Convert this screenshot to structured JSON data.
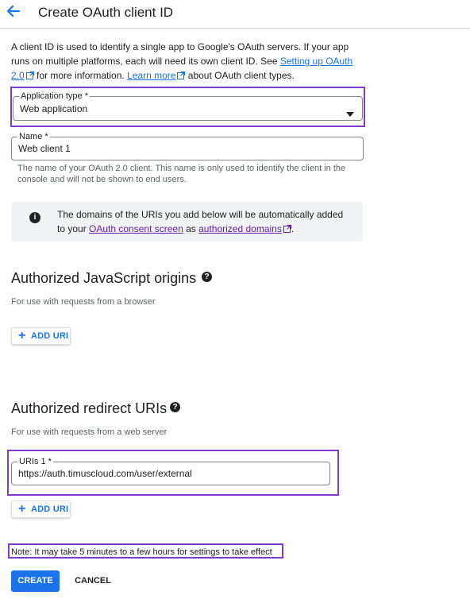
{
  "header": {
    "title": "Create OAuth client ID"
  },
  "intro": {
    "text1": "A client ID is used to identify a single app to Google's OAuth servers. If your app runs on multiple platforms, each will need its own client ID. See ",
    "link1": "Setting up OAuth 2.0",
    "text2": " for more information. ",
    "link2": "Learn more",
    "text3": " about OAuth client types."
  },
  "application_type": {
    "label": "Application type *",
    "value": "Web application"
  },
  "name_field": {
    "label": "Name *",
    "value": "Web client 1",
    "hint": "The name of your OAuth 2.0 client. This name is only used to identify the client in the console and will not be shown to end users."
  },
  "info_box": {
    "text1": "The domains of the URIs you add below will be automatically added to your ",
    "link1": "OAuth consent screen",
    "text2": " as ",
    "link2": "authorized domains",
    "text3": "."
  },
  "js_origins": {
    "title": "Authorized JavaScript origins",
    "subtitle": "For use with requests from a browser",
    "add_label": "ADD URI"
  },
  "redirect_uris": {
    "title": "Authorized redirect URIs",
    "subtitle": "For use with requests from a web server",
    "uri_label": "URIs 1 *",
    "uri_value": "https://auth.timuscloud.com/user/external",
    "add_label": "ADD URI"
  },
  "note": "Note: It may take 5 minutes to a few hours for settings to take effect",
  "actions": {
    "create": "CREATE",
    "cancel": "CANCEL"
  },
  "colors": {
    "accent": "#1a73e8",
    "highlight": "#7e3bcc",
    "info_bg": "#f1f3f4",
    "link_visited": "#681da8"
  },
  "icons": {
    "back": "arrow-back-icon",
    "dropdown": "caret-down-icon",
    "info": "info-icon",
    "help": "help-icon",
    "external": "external-link-icon",
    "add": "plus-icon"
  }
}
